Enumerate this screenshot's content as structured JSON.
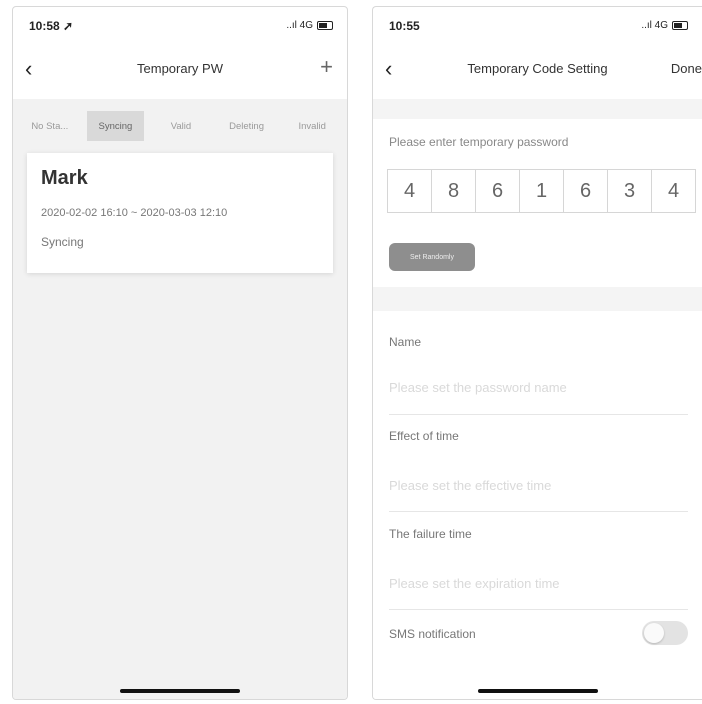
{
  "left_screen": {
    "status": {
      "time": "10:58 ➚",
      "signal": "..ıl 4G"
    },
    "nav": {
      "title": "Temporary PW"
    },
    "tabs": [
      {
        "label": "No Sta..."
      },
      {
        "label": "Syncing",
        "active": true
      },
      {
        "label": "Valid"
      },
      {
        "label": "Deleting"
      },
      {
        "label": "Invalid"
      }
    ],
    "record": {
      "name": "Mark",
      "time_range": "2020-02-02 16:10 ~ 2020-03-03 12:10",
      "status": "Syncing"
    }
  },
  "right_screen": {
    "status": {
      "time": "10:55",
      "signal": "..ıl 4G"
    },
    "nav": {
      "title": "Temporary Code Setting",
      "done_label": "Done"
    },
    "password_prompt": "Please enter temporary password",
    "digits": [
      "4",
      "8",
      "6",
      "1",
      "6",
      "3",
      "4"
    ],
    "random_button_label": "Set Randomly",
    "fields": {
      "name_label": "Name",
      "name_placeholder": "Please set the password name",
      "effect_label": "Effect of time",
      "effect_placeholder": "Please set the effective time",
      "failure_label": "The failure time",
      "failure_placeholder": "Please set the expiration time",
      "sms_label": "SMS notification",
      "sms_enabled": false
    }
  }
}
